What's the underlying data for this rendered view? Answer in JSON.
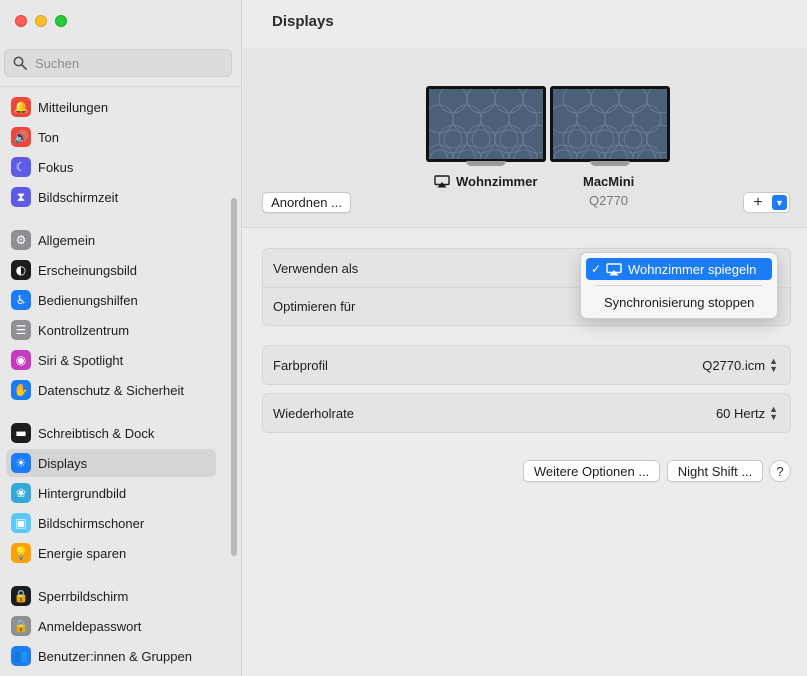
{
  "window": {
    "title": "Displays"
  },
  "search": {
    "placeholder": "Suchen"
  },
  "sidebar": {
    "items": [
      {
        "label": "Mitteilungen",
        "icon": "bell-icon",
        "color": "#f0473c",
        "glyph": "🔔"
      },
      {
        "label": "Ton",
        "icon": "speaker-icon",
        "color": "#f0473c",
        "glyph": "🔊"
      },
      {
        "label": "Fokus",
        "icon": "moon-icon",
        "color": "#5e5ce6",
        "glyph": "☾"
      },
      {
        "label": "Bildschirmzeit",
        "icon": "hourglass-icon",
        "color": "#5e5ce6",
        "glyph": "⧗"
      },
      {
        "label": "Allgemein",
        "icon": "gear-icon",
        "color": "#8e8e93",
        "glyph": "⚙"
      },
      {
        "label": "Erscheinungsbild",
        "icon": "appearance-icon",
        "color": "#1d1d1f",
        "glyph": "◐"
      },
      {
        "label": "Bedienungshilfen",
        "icon": "accessibility-icon",
        "color": "#1b7cf5",
        "glyph": "♿"
      },
      {
        "label": "Kontrollzentrum",
        "icon": "toggles-icon",
        "color": "#8e8e93",
        "glyph": "☰"
      },
      {
        "label": "Siri & Spotlight",
        "icon": "siri-icon",
        "color": "#c33cc0",
        "glyph": "◉"
      },
      {
        "label": "Datenschutz & Sicherheit",
        "icon": "hand-icon",
        "color": "#1b7cf5",
        "glyph": "✋"
      },
      {
        "label": "Schreibtisch & Dock",
        "icon": "dock-icon",
        "color": "#1d1d1f",
        "glyph": "▬"
      },
      {
        "label": "Displays",
        "icon": "sun-icon",
        "color": "#1b7cf5",
        "glyph": "☀"
      },
      {
        "label": "Hintergrundbild",
        "icon": "flower-icon",
        "color": "#34aadc",
        "glyph": "❀"
      },
      {
        "label": "Bildschirmschoner",
        "icon": "screensaver-icon",
        "color": "#5ac8fa",
        "glyph": "▣"
      },
      {
        "label": "Energie sparen",
        "icon": "bulb-icon",
        "color": "#ff9f0a",
        "glyph": "💡"
      },
      {
        "label": "Sperrbildschirm",
        "icon": "lock-screen-icon",
        "color": "#1d1d1f",
        "glyph": "🔒"
      },
      {
        "label": "Anmeldepasswort",
        "icon": "lock-icon",
        "color": "#8e8e93",
        "glyph": "🔒"
      },
      {
        "label": "Benutzer:innen & Gruppen",
        "icon": "users-icon",
        "color": "#1b7cf5",
        "glyph": "👥"
      }
    ],
    "selected": "Displays"
  },
  "arrangement": {
    "arrange_button": "Anordnen ...",
    "displays": [
      {
        "name": "Wohnzimmer",
        "icon": "airplay-icon"
      },
      {
        "name": "MacMini",
        "model": "Q2770"
      }
    ],
    "add_button": "+"
  },
  "settings": {
    "verwenden_als": "Verwenden als",
    "optimieren_fuer": "Optimieren für",
    "farbprofil_label": "Farbprofil",
    "farbprofil_value": "Q2770.icm",
    "wiederholrate_label": "Wiederholrate",
    "wiederholrate_value": "60 Hertz"
  },
  "popup": {
    "items": [
      {
        "label": "Wohnzimmer spiegeln",
        "checked": true,
        "icon": "airplay-icon"
      },
      {
        "label": "Synchronisierung stoppen",
        "checked": false
      }
    ]
  },
  "footer": {
    "more_options": "Weitere Optionen ...",
    "night_shift": "Night Shift ...",
    "help": "?"
  },
  "colors": {
    "accent": "#1b7cf5"
  }
}
